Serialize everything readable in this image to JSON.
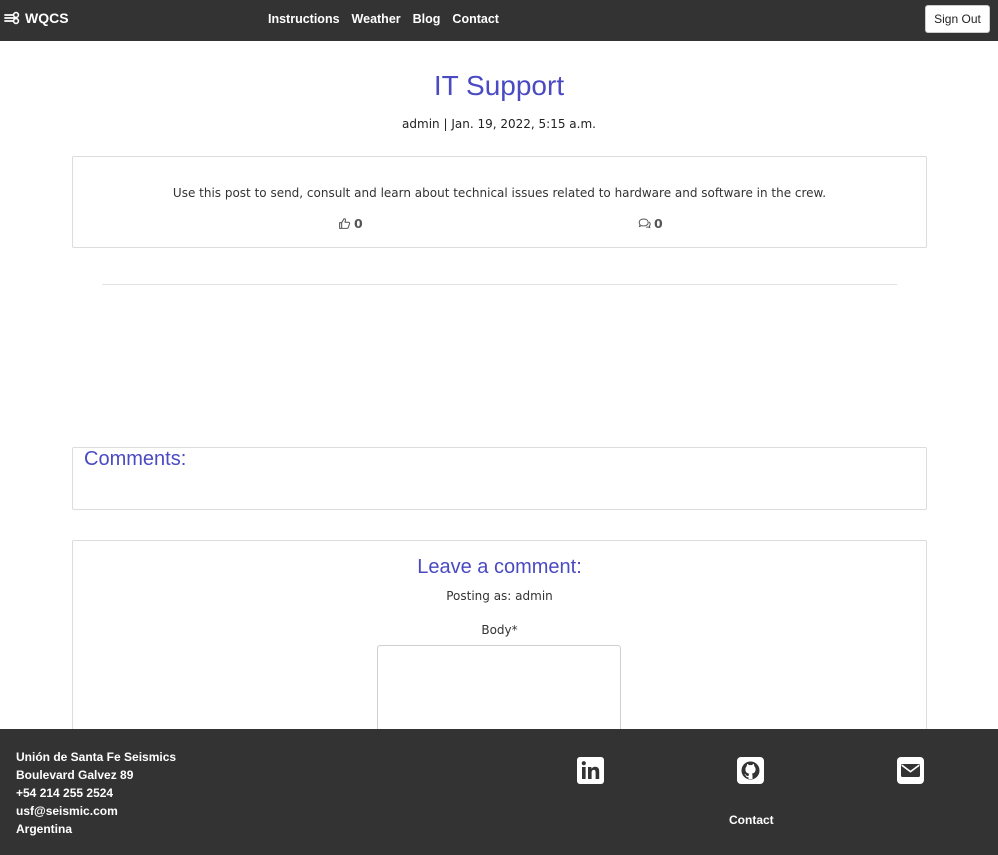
{
  "nav": {
    "brand": "WQCS",
    "links": [
      "Instructions",
      "Weather",
      "Blog",
      "Contact"
    ],
    "sign_out": "Sign Out"
  },
  "post": {
    "title": "IT Support",
    "meta": "admin | Jan. 19, 2022, 5:15 a.m.",
    "body": "Use this post to send, consult and learn about technical issues related to hardware and software in the crew.",
    "likes": "0",
    "comments": "0"
  },
  "comments_section": {
    "heading": "Comments:"
  },
  "comment_form": {
    "heading": "Leave a comment:",
    "posting_as": "Posting as: admin",
    "body_label": "Body*",
    "body_value": ""
  },
  "footer": {
    "address_lines": [
      "Unión de Santa Fe Seismics",
      "Boulevard Galvez 89",
      "+54 214 255 2524",
      "usf@seismic.com",
      "Argentina"
    ],
    "contact_label": "Contact",
    "icons": [
      "linkedin-icon",
      "github-icon",
      "envelope-icon"
    ]
  },
  "colors": {
    "navbar_bg": "#333333",
    "accent": "#4a4ac2",
    "footer_bg": "#333333"
  }
}
